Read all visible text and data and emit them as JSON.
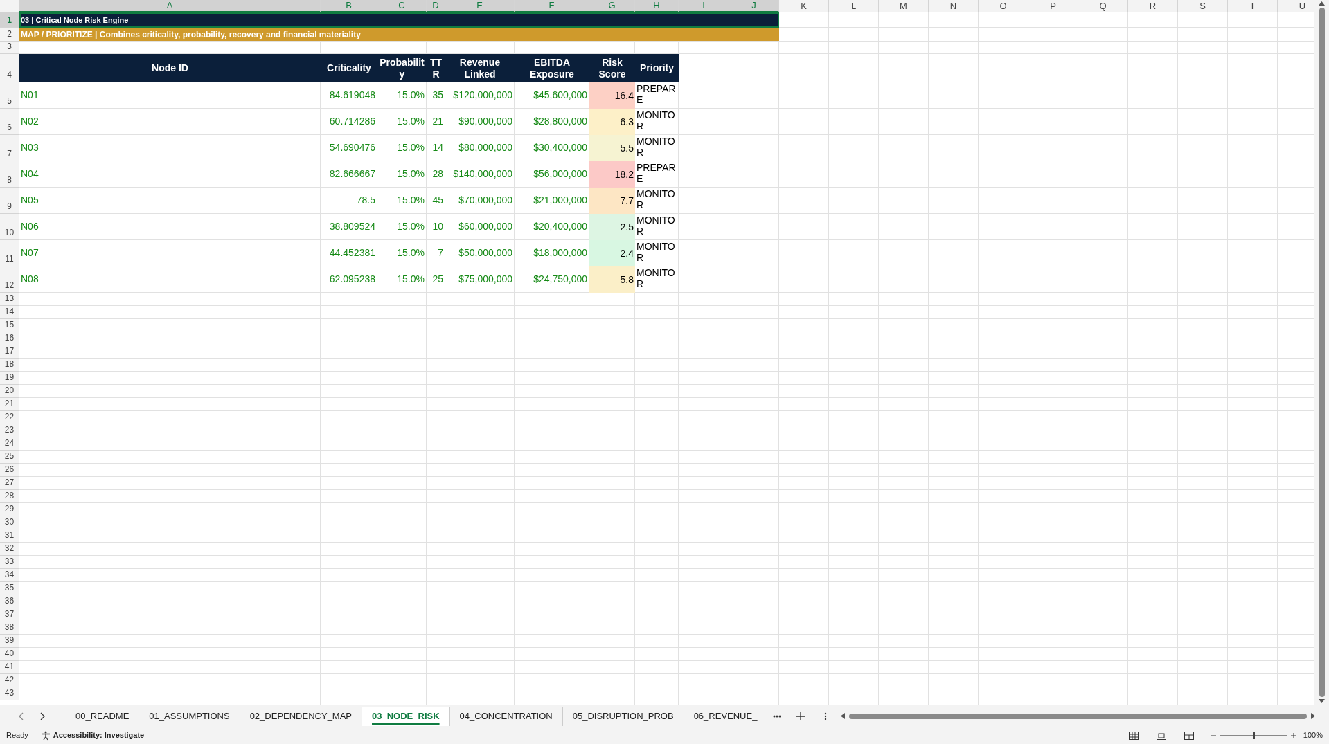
{
  "column_headers": [
    {
      "label": "A",
      "selected": true
    },
    {
      "label": "B",
      "selected": true
    },
    {
      "label": "C",
      "selected": true
    },
    {
      "label": "D",
      "selected": true
    },
    {
      "label": "E",
      "selected": true
    },
    {
      "label": "F",
      "selected": true
    },
    {
      "label": "G",
      "selected": true
    },
    {
      "label": "H",
      "selected": true
    },
    {
      "label": "I",
      "selected": true
    },
    {
      "label": "J",
      "selected": true
    },
    {
      "label": "K",
      "selected": false
    },
    {
      "label": "L",
      "selected": false
    },
    {
      "label": "M",
      "selected": false
    },
    {
      "label": "N",
      "selected": false
    },
    {
      "label": "O",
      "selected": false
    },
    {
      "label": "P",
      "selected": false
    },
    {
      "label": "Q",
      "selected": false
    },
    {
      "label": "R",
      "selected": false
    },
    {
      "label": "S",
      "selected": false
    },
    {
      "label": "T",
      "selected": false
    },
    {
      "label": "U",
      "selected": false
    }
  ],
  "row_numbers": [
    {
      "label": "1",
      "selected": true
    },
    {
      "label": "2",
      "selected": false
    },
    {
      "label": "3",
      "selected": false
    },
    {
      "label": "4",
      "selected": false
    },
    {
      "label": "5",
      "selected": false
    },
    {
      "label": "6",
      "selected": false
    },
    {
      "label": "7",
      "selected": false
    },
    {
      "label": "8",
      "selected": false
    },
    {
      "label": "9",
      "selected": false
    },
    {
      "label": "10",
      "selected": false
    },
    {
      "label": "11",
      "selected": false
    },
    {
      "label": "12",
      "selected": false
    },
    {
      "label": "13",
      "selected": false
    },
    {
      "label": "14",
      "selected": false
    },
    {
      "label": "15",
      "selected": false
    },
    {
      "label": "16",
      "selected": false
    },
    {
      "label": "17",
      "selected": false
    },
    {
      "label": "18",
      "selected": false
    },
    {
      "label": "19",
      "selected": false
    },
    {
      "label": "20",
      "selected": false
    },
    {
      "label": "21",
      "selected": false
    },
    {
      "label": "22",
      "selected": false
    },
    {
      "label": "23",
      "selected": false
    },
    {
      "label": "24",
      "selected": false
    },
    {
      "label": "25",
      "selected": false
    },
    {
      "label": "26",
      "selected": false
    },
    {
      "label": "27",
      "selected": false
    },
    {
      "label": "28",
      "selected": false
    },
    {
      "label": "29",
      "selected": false
    },
    {
      "label": "30",
      "selected": false
    },
    {
      "label": "31",
      "selected": false
    },
    {
      "label": "32",
      "selected": false
    },
    {
      "label": "33",
      "selected": false
    },
    {
      "label": "34",
      "selected": false
    },
    {
      "label": "35",
      "selected": false
    },
    {
      "label": "36",
      "selected": false
    },
    {
      "label": "37",
      "selected": false
    },
    {
      "label": "38",
      "selected": false
    },
    {
      "label": "39",
      "selected": false
    },
    {
      "label": "40",
      "selected": false
    },
    {
      "label": "41",
      "selected": false
    },
    {
      "label": "42",
      "selected": false
    },
    {
      "label": "43",
      "selected": false
    }
  ],
  "title": "03 | Critical Node Risk Engine",
  "subtitle": "MAP / PRIORITIZE | Combines criticality, probability, recovery and financial materiality",
  "table": {
    "columns": [
      "Node ID",
      "Criticality",
      "Probability",
      "TTR",
      "Revenue Linked",
      "EBITDA Exposure",
      "Risk Score",
      "Priority"
    ],
    "rows": [
      {
        "node_id": "N01",
        "criticality": "84.619048",
        "probability": "15.0%",
        "ttr": "35",
        "revenue_linked": "$120,000,000",
        "ebitda_exposure": "$45,600,000",
        "risk_score": "16.4",
        "color": "#fdd0c5",
        "priority": "PREPARE"
      },
      {
        "node_id": "N02",
        "criticality": "60.714286",
        "probability": "15.0%",
        "ttr": "21",
        "revenue_linked": "$90,000,000",
        "ebitda_exposure": "$28,800,000",
        "risk_score": "6.3",
        "color": "#fdf0c8",
        "priority": "MONITOR"
      },
      {
        "node_id": "N03",
        "criticality": "54.690476",
        "probability": "15.0%",
        "ttr": "14",
        "revenue_linked": "$80,000,000",
        "ebitda_exposure": "$30,400,000",
        "risk_score": "5.5",
        "color": "#f6f3d2",
        "priority": "MONITOR"
      },
      {
        "node_id": "N04",
        "criticality": "82.666667",
        "probability": "15.0%",
        "ttr": "28",
        "revenue_linked": "$140,000,000",
        "ebitda_exposure": "$56,000,000",
        "risk_score": "18.2",
        "color": "#fcc9c7",
        "priority": "PREPARE"
      },
      {
        "node_id": "N05",
        "criticality": "78.5",
        "probability": "15.0%",
        "ttr": "45",
        "revenue_linked": "$70,000,000",
        "ebitda_exposure": "$21,000,000",
        "risk_score": "7.7",
        "color": "#fde6c4",
        "priority": "MONITOR"
      },
      {
        "node_id": "N06",
        "criticality": "38.809524",
        "probability": "15.0%",
        "ttr": "10",
        "revenue_linked": "$60,000,000",
        "ebitda_exposure": "$20,400,000",
        "risk_score": "2.5",
        "color": "#ddf5e3",
        "priority": "MONITOR"
      },
      {
        "node_id": "N07",
        "criticality": "44.452381",
        "probability": "15.0%",
        "ttr": "7",
        "revenue_linked": "$50,000,000",
        "ebitda_exposure": "$18,000,000",
        "risk_score": "2.4",
        "color": "#d8f7e2",
        "priority": "MONITOR"
      },
      {
        "node_id": "N08",
        "criticality": "62.095238",
        "probability": "15.0%",
        "ttr": "25",
        "revenue_linked": "$75,000,000",
        "ebitda_exposure": "$24,750,000",
        "risk_score": "5.8",
        "color": "#fbefc8",
        "priority": "MONITOR"
      }
    ]
  },
  "sheet_tabs": [
    {
      "label": "00_README",
      "selected": false
    },
    {
      "label": "01_ASSUMPTIONS",
      "selected": false
    },
    {
      "label": "02_DEPENDENCY_MAP",
      "selected": false
    },
    {
      "label": "03_NODE_RISK",
      "selected": true
    },
    {
      "label": "04_CONCENTRATION",
      "selected": false
    },
    {
      "label": "05_DISRUPTION_PROB",
      "selected": false
    },
    {
      "label": "06_REVENUE_",
      "selected": false
    }
  ],
  "status_bar": {
    "status": "Ready",
    "accessibility": "Accessibility: Investigate",
    "zoom": {
      "label": "100%",
      "level": 0.5
    }
  }
}
